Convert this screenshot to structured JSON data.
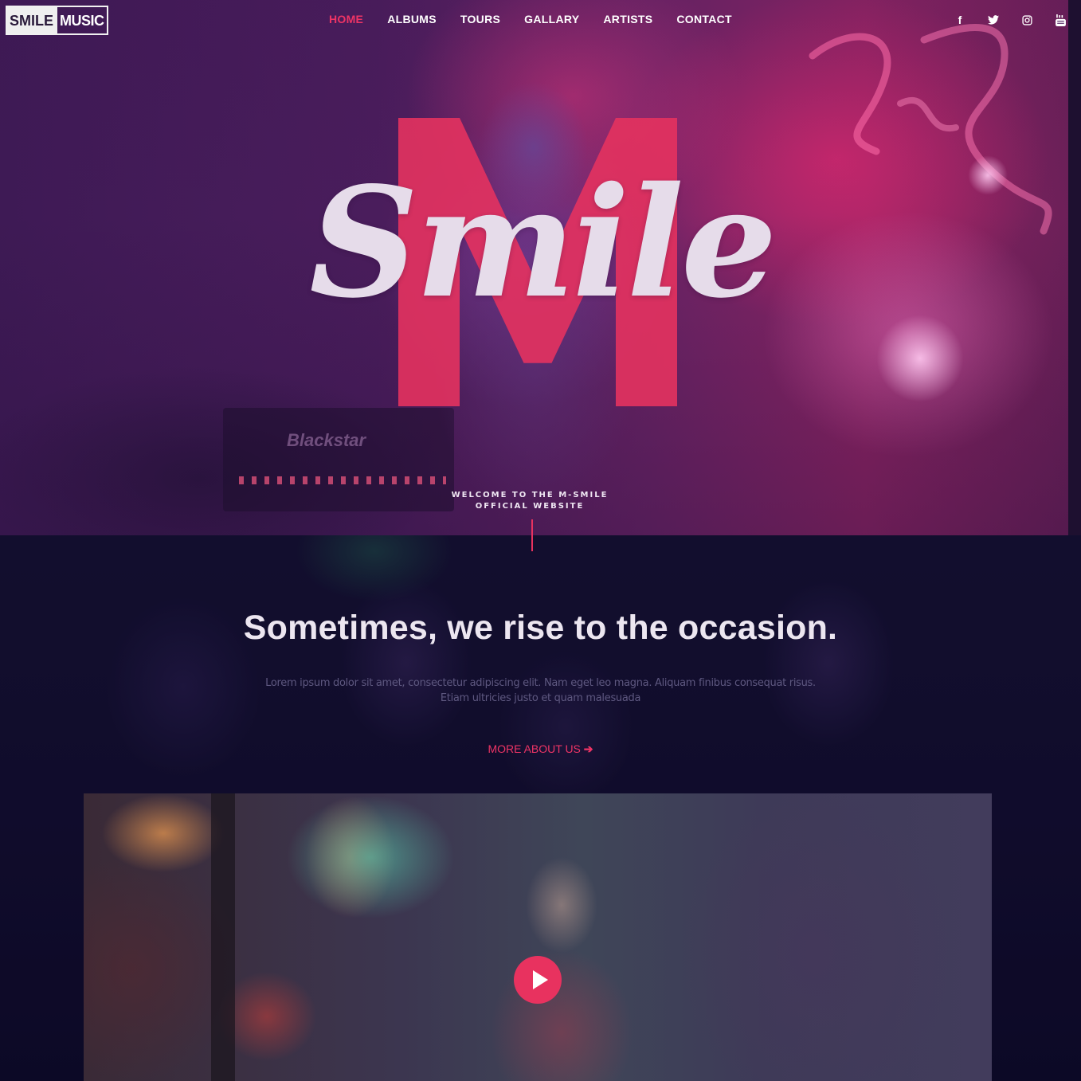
{
  "brand": {
    "logo_part1": "SMILE",
    "logo_part2": "MUSIC"
  },
  "nav": {
    "items": [
      {
        "label": "HOME",
        "active": true
      },
      {
        "label": "ALBUMS",
        "active": false
      },
      {
        "label": "TOURS",
        "active": false
      },
      {
        "label": "GALLARY",
        "active": false
      },
      {
        "label": "ARTISTS",
        "active": false
      },
      {
        "label": "CONTACT",
        "active": false
      }
    ]
  },
  "social": {
    "facebook": "f",
    "twitter": "twitter-icon",
    "instagram": "instagram-icon",
    "youtube": "youtube-icon"
  },
  "hero": {
    "big_letter": "M",
    "script_title": "Smile",
    "amp_brand": "Blackstar",
    "welcome_line1": "WELCOME TO THE M-SMILE",
    "welcome_line2": "OFFICIAL WEBSITE"
  },
  "about": {
    "headline": "Sometimes, we rise to the occasion.",
    "body": "Lorem ipsum dolor sit amet, consectetur adipiscing elit. Nam eget leo magna. Aliquam finibus consequat risus. Etiam ultricies justo et quam malesuada",
    "more_link": "MORE ABOUT US"
  },
  "video": {
    "play_icon": "play-icon"
  },
  "colors": {
    "accent": "#e8325f",
    "nav_active": "#ee3465",
    "hero_purple": "#4a1d5c",
    "section_dark": "#120f2e"
  }
}
